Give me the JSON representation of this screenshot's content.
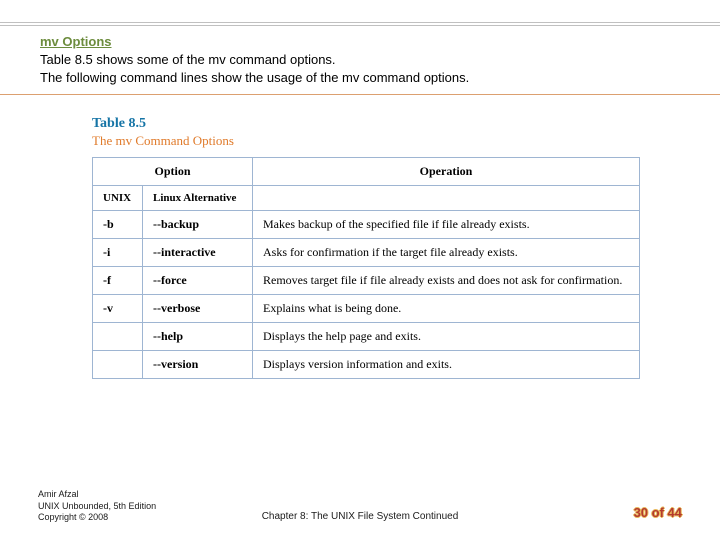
{
  "header": {
    "heading": "mv Options",
    "intro1": "Table 8.5 shows some of the mv command options.",
    "intro2": "The following command lines show the usage of the mv command options."
  },
  "table": {
    "label": "Table 8.5",
    "title": "The mv Command Options",
    "head_option": "Option",
    "head_operation": "Operation",
    "sub_unix": "UNIX",
    "sub_linux": "Linux Alternative",
    "rows": [
      {
        "unix": "-b",
        "linux": "--backup",
        "op": "Makes backup of the specified file if file already exists."
      },
      {
        "unix": "-i",
        "linux": "--interactive",
        "op": "Asks for confirmation if the target file already exists."
      },
      {
        "unix": "-f",
        "linux": "--force",
        "op": "Removes target file if file already exists and does not ask for confirmation."
      },
      {
        "unix": "-v",
        "linux": "--verbose",
        "op": "Explains what is being done."
      },
      {
        "unix": "",
        "linux": "--help",
        "op": "Displays the help page and exits."
      },
      {
        "unix": "",
        "linux": "--version",
        "op": "Displays version information and exits."
      }
    ]
  },
  "footer": {
    "author_line1": "Amir Afzal",
    "author_line2": "UNIX Unbounded, 5th Edition",
    "author_line3": "Copyright © 2008",
    "chapter": "Chapter 8: The UNIX File System Continued",
    "pager": "30 of 44"
  },
  "chart_data": {
    "type": "table",
    "title": "Table 8.5 — The mv Command Options",
    "columns": [
      "UNIX",
      "Linux Alternative",
      "Operation"
    ],
    "rows": [
      [
        "-b",
        "--backup",
        "Makes backup of the specified file if file already exists."
      ],
      [
        "-i",
        "--interactive",
        "Asks for confirmation if the target file already exists."
      ],
      [
        "-f",
        "--force",
        "Removes target file if file already exists and does not ask for confirmation."
      ],
      [
        "-v",
        "--verbose",
        "Explains what is being done."
      ],
      [
        "",
        "--help",
        "Displays the help page and exits."
      ],
      [
        "",
        "--version",
        "Displays version information and exits."
      ]
    ]
  }
}
